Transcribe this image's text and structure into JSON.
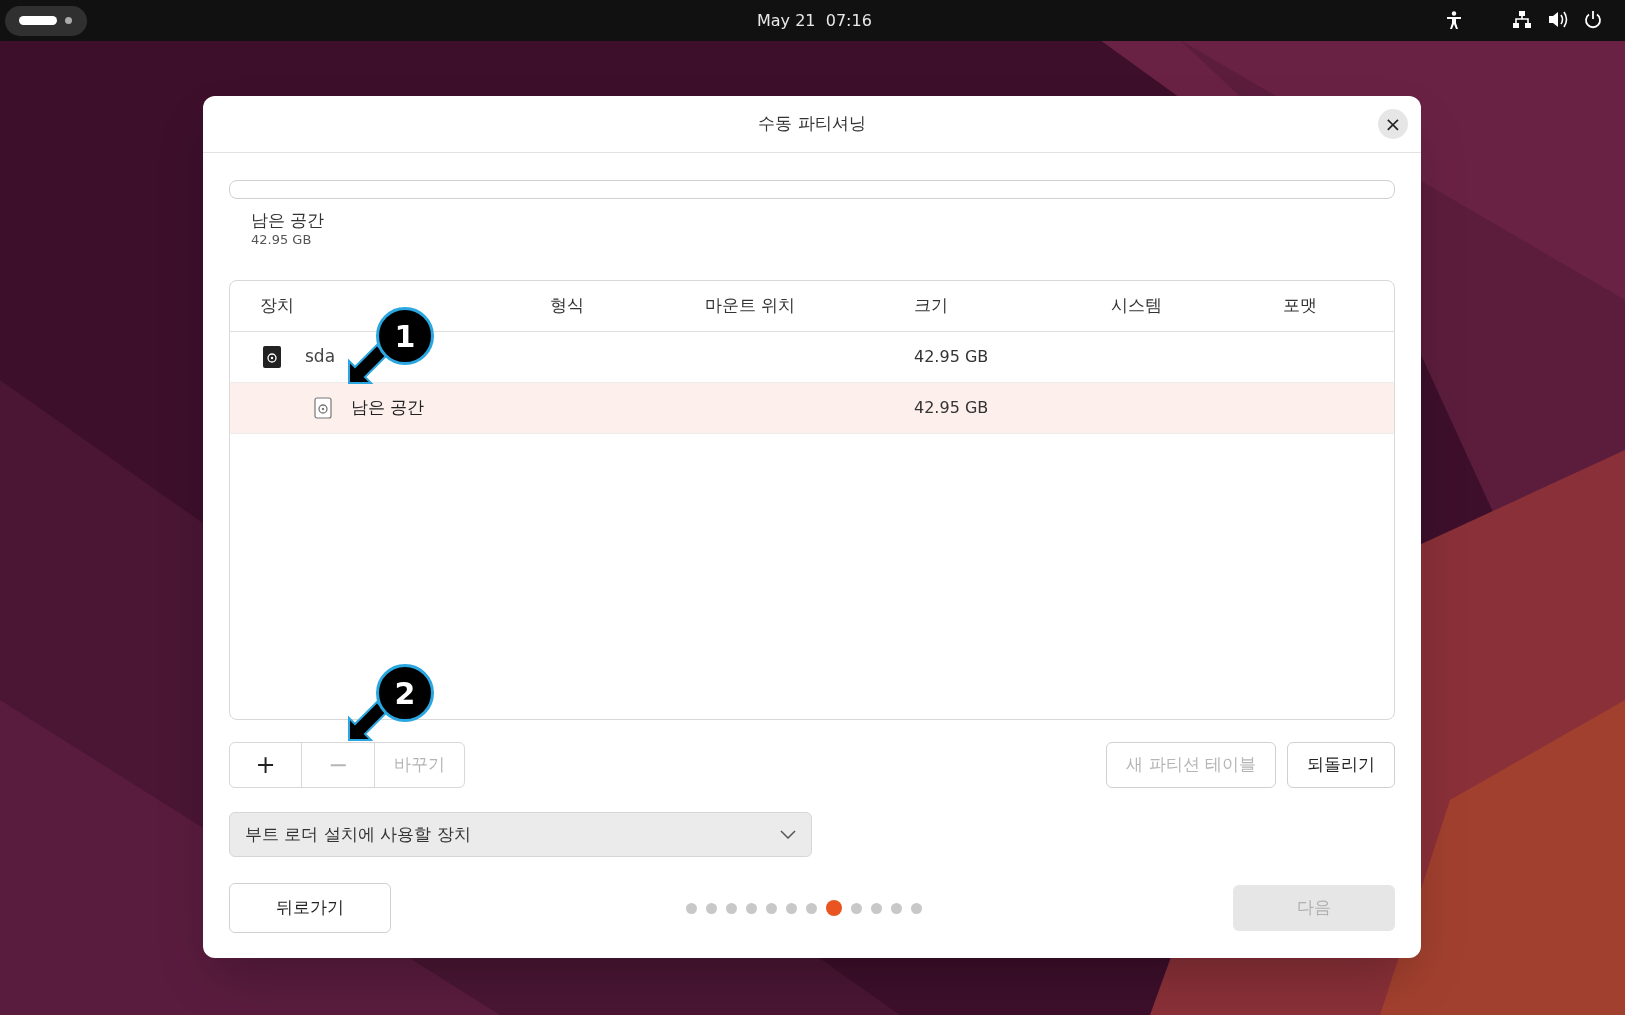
{
  "top_bar": {
    "clock": "May 21  07:16"
  },
  "dialog": {
    "title": "수동 파티셔닝",
    "close": "×",
    "usage": {
      "label": "남은 공간",
      "size": "42.95 GB"
    },
    "table": {
      "columns": [
        "장치",
        "형식",
        "마운트 위치",
        "크기",
        "시스템",
        "포맷"
      ],
      "rows": [
        {
          "name": "sda",
          "size": "42.95 GB",
          "selected": false,
          "children": [
            {
              "name": "남은 공간",
              "size": "42.95 GB",
              "selected": true
            }
          ]
        }
      ]
    },
    "actions": [
      {
        "label": "+",
        "disabled": false
      },
      {
        "label": "−",
        "disabled": true
      },
      {
        "label": "바꾸기",
        "disabled": true
      }
    ],
    "right_actions": [
      {
        "label": "새 파티션 테이블",
        "disabled": true
      },
      {
        "label": "되돌리기",
        "disabled": false
      }
    ],
    "bootloader": {
      "placeholder": "부트 로더 설치에 사용할 장치"
    },
    "back": {
      "label": "뒤로가기",
      "disabled": false
    },
    "steps": [
      {
        "selected": false
      },
      {
        "selected": false
      },
      {
        "selected": false
      },
      {
        "selected": false
      },
      {
        "selected": false
      },
      {
        "selected": false
      },
      {
        "selected": false
      },
      {
        "selected": true
      },
      {
        "selected": false
      },
      {
        "selected": false
      },
      {
        "selected": false
      },
      {
        "selected": false
      }
    ],
    "next": {
      "label": "다음",
      "disabled": true
    }
  },
  "callouts": [
    {
      "label": "1"
    },
    {
      "label": "2"
    }
  ]
}
